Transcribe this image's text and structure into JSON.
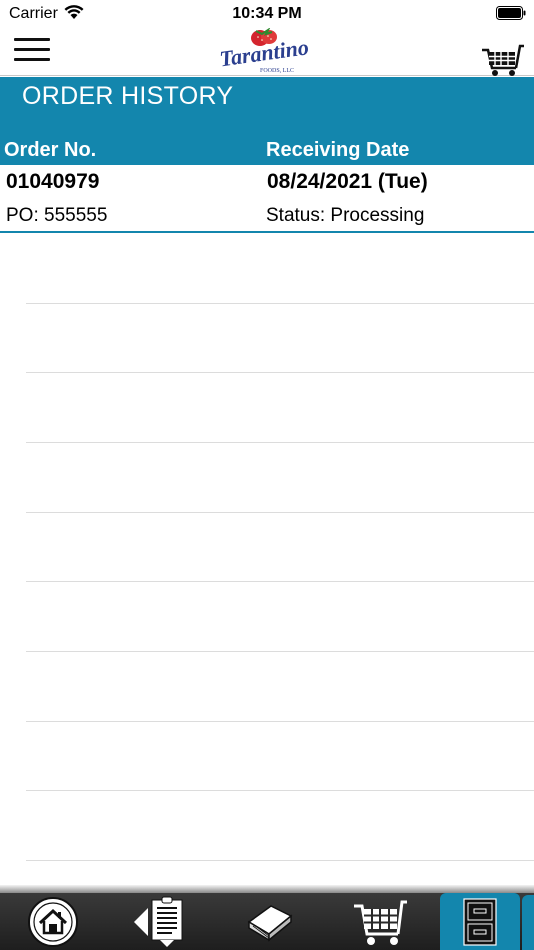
{
  "status_bar": {
    "carrier": "Carrier",
    "time": "10:34 PM"
  },
  "nav_bar": {
    "logo_name": "Tarantino",
    "logo_sub": "FOODS, LLC",
    "menu_icon": "hamburger-menu-icon",
    "cart_icon": "shopping-cart-icon"
  },
  "header": {
    "title": "ORDER HISTORY",
    "columns": [
      "Order No.",
      "Receiving Date"
    ]
  },
  "orders": [
    {
      "order_no": "01040979",
      "receiving_date": "08/24/2021 (Tue)",
      "po": "PO: 555555",
      "status": "Status: Processing"
    }
  ],
  "tab_bar": {
    "tabs": [
      {
        "icon": "home-icon"
      },
      {
        "icon": "order-list-icon"
      },
      {
        "icon": "catalog-book-icon"
      },
      {
        "icon": "cart-icon"
      },
      {
        "icon": "file-cabinet-icon"
      }
    ],
    "selected": "file-cabinet-icon"
  },
  "colors": {
    "accent": "#1386ad",
    "tab_bar": "#2a2a2a"
  }
}
